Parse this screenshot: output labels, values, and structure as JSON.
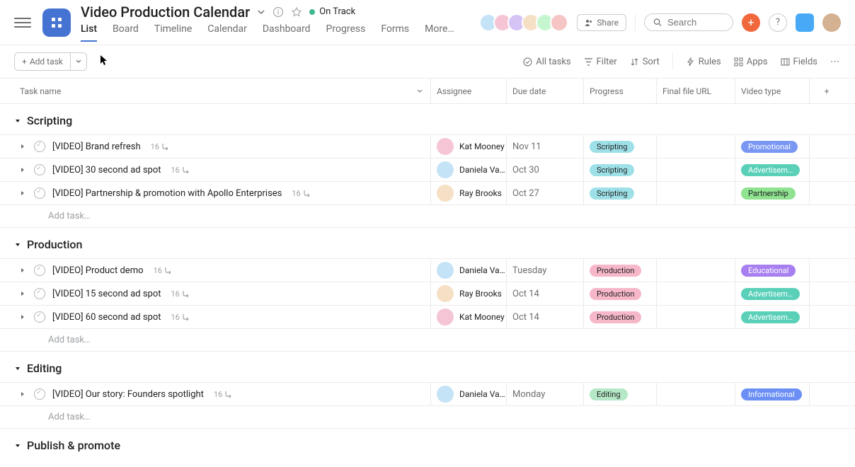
{
  "header": {
    "project_title": "Video Production Calendar",
    "status_label": "On Track",
    "tabs": [
      "List",
      "Board",
      "Timeline",
      "Calendar",
      "Dashboard",
      "Progress",
      "Forms",
      "More…"
    ],
    "active_tab": "List",
    "share_label": "Share",
    "search_placeholder": "Search"
  },
  "toolbar": {
    "add_task_label": "Add task",
    "all_tasks": "All tasks",
    "filter": "Filter",
    "sort": "Sort",
    "rules": "Rules",
    "apps": "Apps",
    "fields": "Fields"
  },
  "columns": {
    "task": "Task name",
    "assignee": "Assignee",
    "due": "Due date",
    "progress": "Progress",
    "url": "Final file URL",
    "type": "Video type"
  },
  "add_task_placeholder": "Add task…",
  "sections": [
    {
      "name": "Scripting",
      "tasks": [
        {
          "name": "[VIDEO] Brand refresh",
          "sub": "16",
          "assignee": "Kat Mooney",
          "av": "avB",
          "due": "Nov 11",
          "progress": {
            "label": "Scripting",
            "bg": "#9ee0e7"
          },
          "type": {
            "label": "Promotional",
            "bg": "#7a97f4",
            "fg": "#fff"
          }
        },
        {
          "name": "[VIDEO] 30 second ad spot",
          "sub": "16",
          "assignee": "Daniela Var…",
          "av": "avA",
          "due": "Oct 30",
          "progress": {
            "label": "Scripting",
            "bg": "#9ee0e7"
          },
          "type": {
            "label": "Advertisem…",
            "bg": "#5ad0b9",
            "fg": "#fff"
          }
        },
        {
          "name": "[VIDEO] Partnership & promotion with Apollo Enterprises",
          "sub": "16",
          "assignee": "Ray Brooks",
          "av": "avD",
          "due": "Oct 27",
          "progress": {
            "label": "Scripting",
            "bg": "#9ee0e7"
          },
          "type": {
            "label": "Partnership",
            "bg": "#8fe28f"
          }
        }
      ]
    },
    {
      "name": "Production",
      "tasks": [
        {
          "name": "[VIDEO] Product demo",
          "sub": "16",
          "assignee": "Daniela Var…",
          "av": "avA",
          "due": "Tuesday",
          "progress": {
            "label": "Production",
            "bg": "#f6b7c9"
          },
          "type": {
            "label": "Educational",
            "bg": "#a77ff0",
            "fg": "#fff"
          }
        },
        {
          "name": "[VIDEO] 15 second ad spot",
          "sub": "16",
          "assignee": "Ray Brooks",
          "av": "avD",
          "due": "Oct 14",
          "progress": {
            "label": "Production",
            "bg": "#f6b7c9"
          },
          "type": {
            "label": "Advertisem…",
            "bg": "#5ad0b9",
            "fg": "#fff"
          }
        },
        {
          "name": "[VIDEO] 60 second ad spot",
          "sub": "16",
          "assignee": "Kat Mooney",
          "av": "avB",
          "due": "Oct 14",
          "progress": {
            "label": "Production",
            "bg": "#f6b7c9"
          },
          "type": {
            "label": "Advertisem…",
            "bg": "#5ad0b9",
            "fg": "#fff"
          }
        }
      ]
    },
    {
      "name": "Editing",
      "tasks": [
        {
          "name": "[VIDEO] Our story: Founders spotlight",
          "sub": "16",
          "assignee": "Daniela Var…",
          "av": "avA",
          "due": "Monday",
          "progress": {
            "label": "Editing",
            "bg": "#b5e8c6"
          },
          "type": {
            "label": "Informational",
            "bg": "#6b8ff5",
            "fg": "#fff"
          }
        }
      ]
    },
    {
      "name": "Publish & promote",
      "tasks": []
    }
  ]
}
